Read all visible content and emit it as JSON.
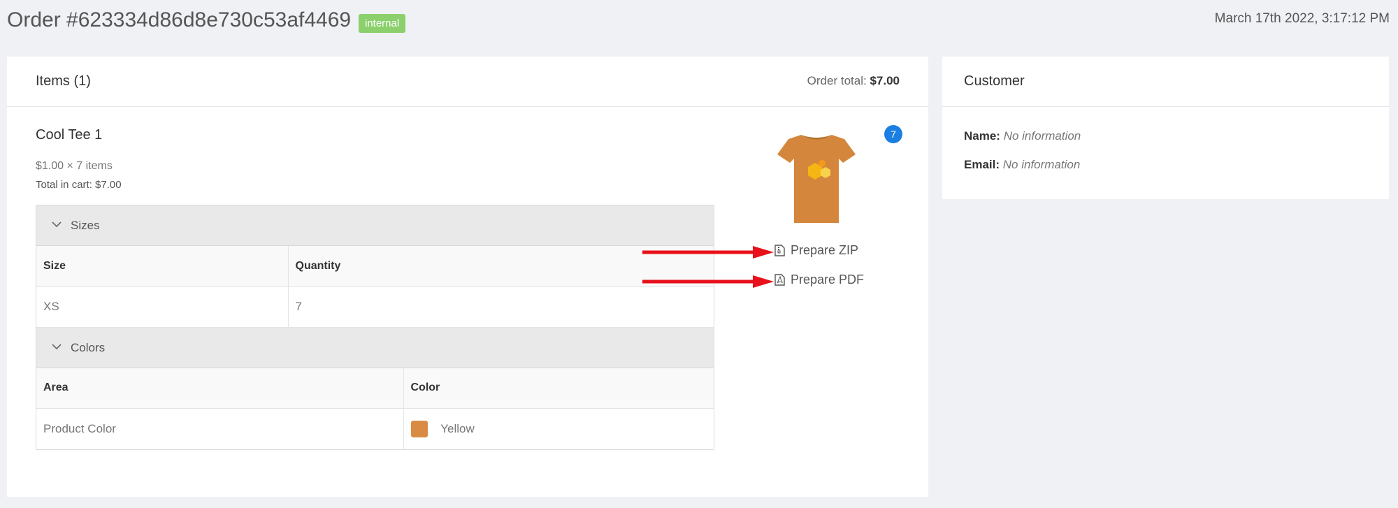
{
  "header": {
    "order_title": "Order #623334d86d8e730c53af4469",
    "badge": "internal",
    "date": "March 17th 2022, 3:17:12 PM"
  },
  "items_card": {
    "title": "Items (1)",
    "order_total_label": "Order total:",
    "order_total_value": "$7.00",
    "product": {
      "name": "Cool Tee 1",
      "price_line": "$1.00 × 7 items",
      "cart_total": "Total in cart: $7.00",
      "quantity_badge": "7",
      "image_icon": "t-shirt-image"
    },
    "sizes": {
      "label": "Sizes",
      "columns": [
        "Size",
        "Quantity"
      ],
      "rows": [
        [
          "XS",
          "7"
        ]
      ]
    },
    "colors": {
      "label": "Colors",
      "columns": [
        "Area",
        "Color"
      ],
      "rows": [
        [
          "Product Color",
          "Yellow"
        ]
      ],
      "swatch_color": "#d98b46"
    },
    "actions": {
      "zip": "Prepare ZIP",
      "pdf": "Prepare PDF"
    }
  },
  "customer_card": {
    "title": "Customer",
    "name_label": "Name:",
    "name_value": "No information",
    "email_label": "Email:",
    "email_value": "No information"
  },
  "colors": {
    "badge_green": "#8bd06c",
    "badge_blue": "#1a7fe0",
    "arrow_red": "#e8111b",
    "background": "#eff1f5"
  }
}
